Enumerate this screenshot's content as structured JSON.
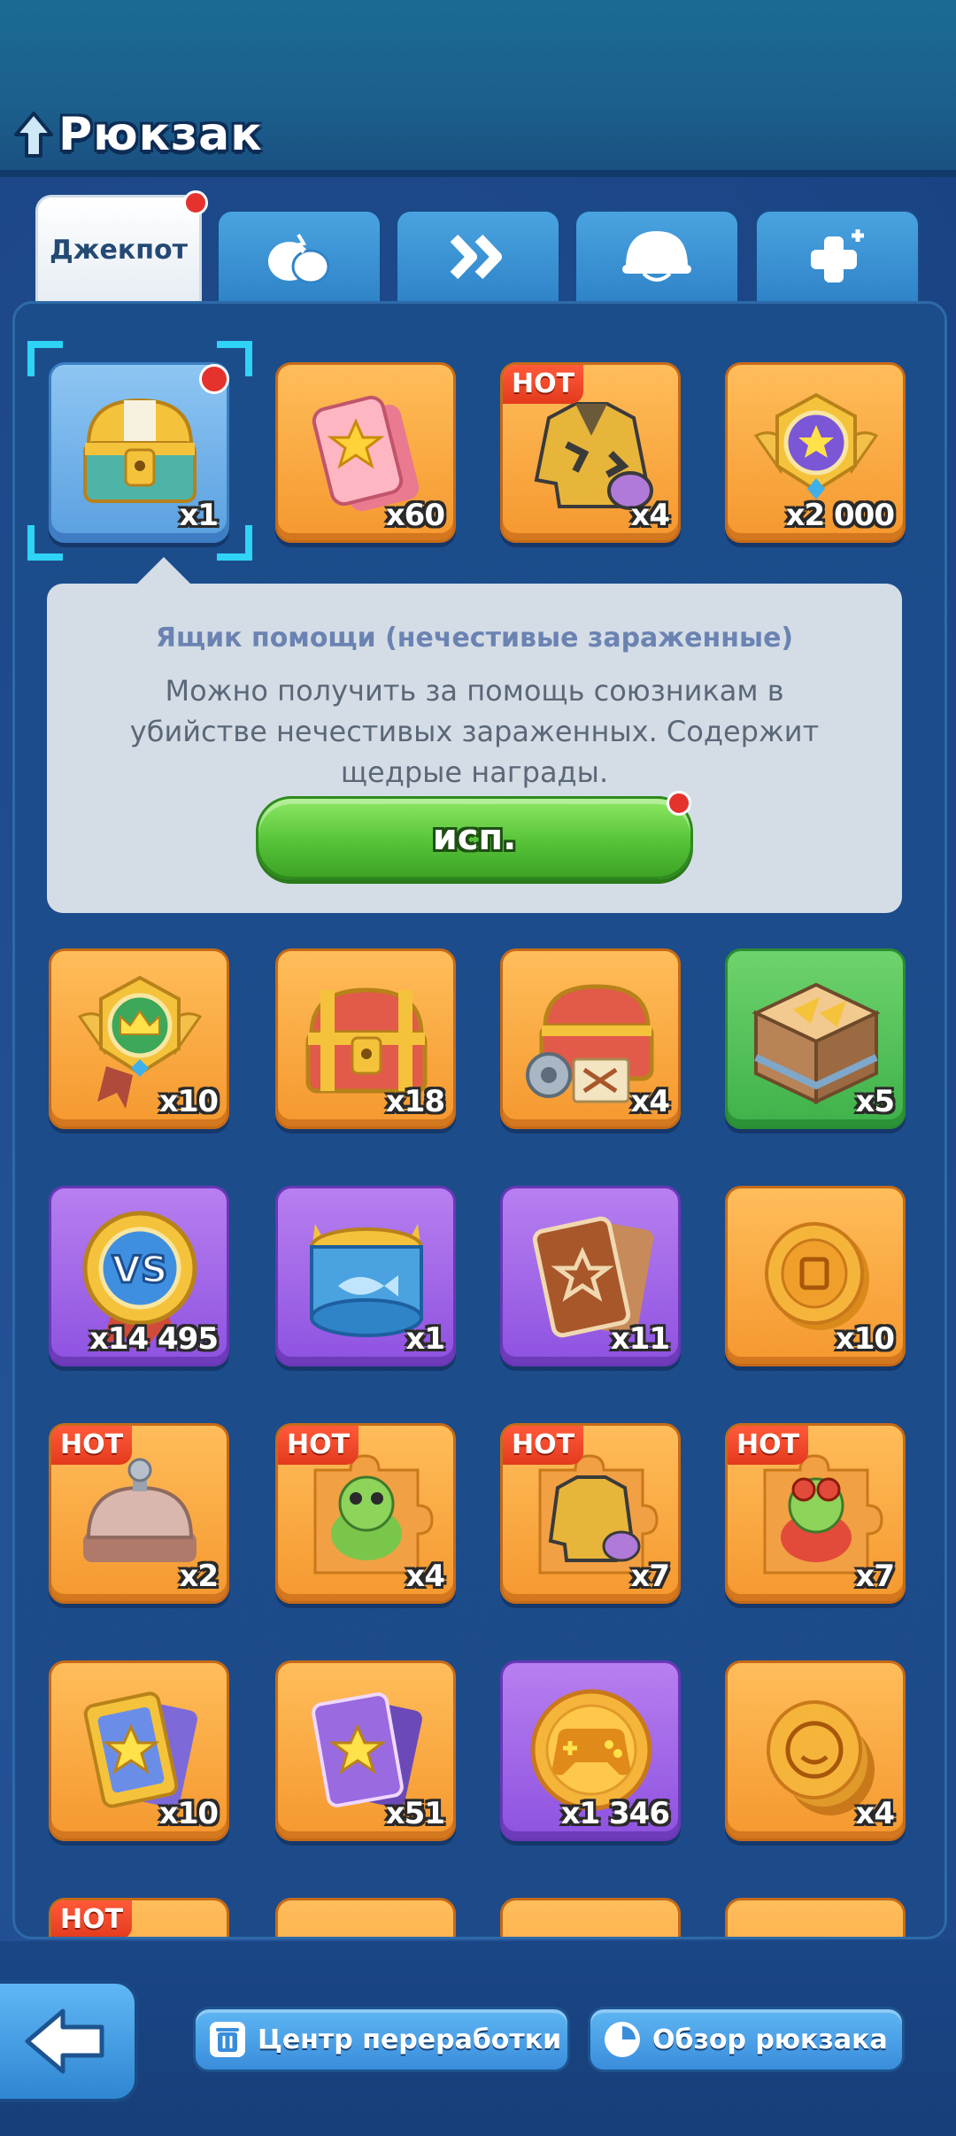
{
  "header": {
    "title": "Рюкзак"
  },
  "tabs": [
    {
      "label": "Джекпот",
      "active": true,
      "badge": true
    },
    {
      "icon": "egg-icon"
    },
    {
      "icon": "double-chevron-icon"
    },
    {
      "icon": "helmet-icon"
    },
    {
      "icon": "plus-sparkle-icon"
    }
  ],
  "items_row1": [
    {
      "name": "rescue-chest",
      "count": "x1",
      "selected": true,
      "badge": true
    },
    {
      "name": "star-ticket",
      "count": "x60"
    },
    {
      "name": "gold-jacket",
      "count": "x4",
      "hot": "HOT"
    },
    {
      "name": "star-medal",
      "count": "x2 000"
    }
  ],
  "tooltip": {
    "title": "Ящик помощи (нечестивые зараженные)",
    "description": "Можно получить за помощь союзникам в убийстве нечестивых зараженных. Содержит щедрые награды.",
    "button": "исп."
  },
  "items_row2": [
    {
      "name": "crown-medal",
      "count": "x10"
    },
    {
      "name": "red-chest",
      "count": "x18"
    },
    {
      "name": "gear-chest",
      "count": "x4"
    },
    {
      "name": "speed-crate",
      "count": "x5"
    }
  ],
  "items_row3": [
    {
      "name": "vs-badge",
      "count": "x14 495"
    },
    {
      "name": "fish-can",
      "count": "x1"
    },
    {
      "name": "star-card",
      "count": "x11"
    },
    {
      "name": "gold-coin",
      "count": "x10"
    }
  ],
  "items_row4": [
    {
      "name": "service-bell",
      "count": "x2",
      "hot": "HOT"
    },
    {
      "name": "frog-puzzle",
      "count": "x4",
      "hot": "HOT"
    },
    {
      "name": "jacket-puzzle",
      "count": "x7",
      "hot": "HOT"
    },
    {
      "name": "frog-glasses-puzzle",
      "count": "x7",
      "hot": "HOT"
    }
  ],
  "items_row5": [
    {
      "name": "blue-star-card",
      "count": "x10"
    },
    {
      "name": "purple-star-card",
      "count": "x51"
    },
    {
      "name": "game-coin",
      "count": "x1 346"
    },
    {
      "name": "face-coin",
      "count": "x4"
    }
  ],
  "items_row6_hot": "HOT",
  "bottom": {
    "recycle_label": "Центр переработки",
    "overview_label": "Обзор рюкзака"
  },
  "colors": {
    "tile_orange": "#f5982f",
    "tile_purple": "#8e52e0",
    "tile_green": "#3fb14a",
    "hot_red": "#e33a1d",
    "use_button_green": "#56c338"
  }
}
